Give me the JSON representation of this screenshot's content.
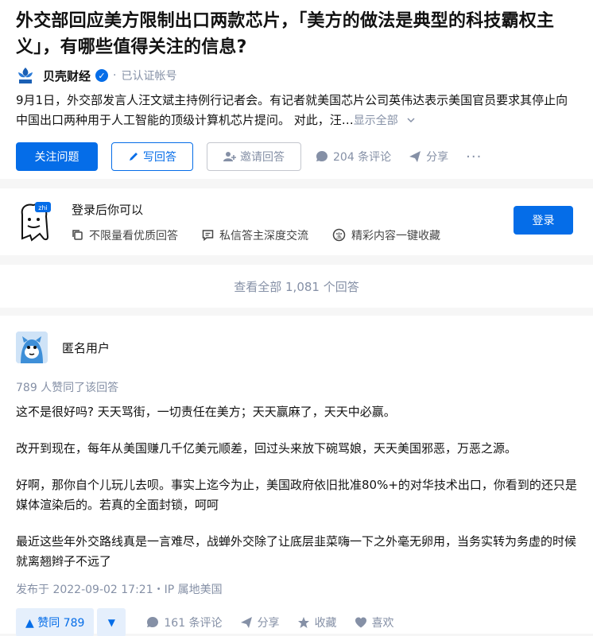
{
  "question": {
    "title": "外交部回应美方限制出口两款芯片，「美方的做法是典型的科技霸权主义」，有哪些值得关注的信息?",
    "author": {
      "name": "贝壳财经",
      "tag": "已认证帐号",
      "logo_text": "贝壳财经"
    },
    "excerpt": "9月1日，外交部发言人汪文斌主持例行记者会。有记者就美国芯片公司英伟达表示美国官员要求其停止向中国出口两种用于人工智能的顶级计算机芯片提问。 对此，汪…",
    "show_all": "显示全部",
    "actions": {
      "follow": "关注问题",
      "write": "写回答",
      "invite": "邀请回答",
      "comments": "204 条评论",
      "share": "分享",
      "more": "···"
    }
  },
  "login": {
    "title": "登录后你可以",
    "perks": [
      "不限量看优质回答",
      "私信答主深度交流",
      "精彩内容一键收藏"
    ],
    "button": "登录"
  },
  "view_all": "查看全部 1,081 个回答",
  "answer": {
    "user": "匿名用户",
    "voters": "789 人赞同了该回答",
    "paragraphs": [
      "这不是很好吗? 天天骂街，一切责任在美方；天天赢麻了，天天中必赢。",
      "改开到现在，每年从美国赚几千亿美元顺差，回过头来放下碗骂娘，天天美国邪恶，万恶之源。",
      "好啊，那你自个儿玩儿去呗。事实上迄今为止，美国政府依旧批准80%+的对华技术出口，你看到的还只是媒体渲染后的。若真的全面封锁，呵呵",
      "最近这些年外交路线真是一言难尽，战蝉外交除了让底层韭菜嗨一下之外毫无卵用，当务实转为务虚的时候就离翘辫子不远了"
    ],
    "published": "发布于 2022-09-02 17:21・IP 属地美国",
    "actions": {
      "upvote": "▲ 赞同 789",
      "downvote": "▼",
      "comments": "161 条评论",
      "share": "分享",
      "favorite": "收藏",
      "like": "喜欢"
    }
  },
  "colors": {
    "accent": "#056de8",
    "muted": "#8590a6",
    "background": "#f6f6f6"
  }
}
